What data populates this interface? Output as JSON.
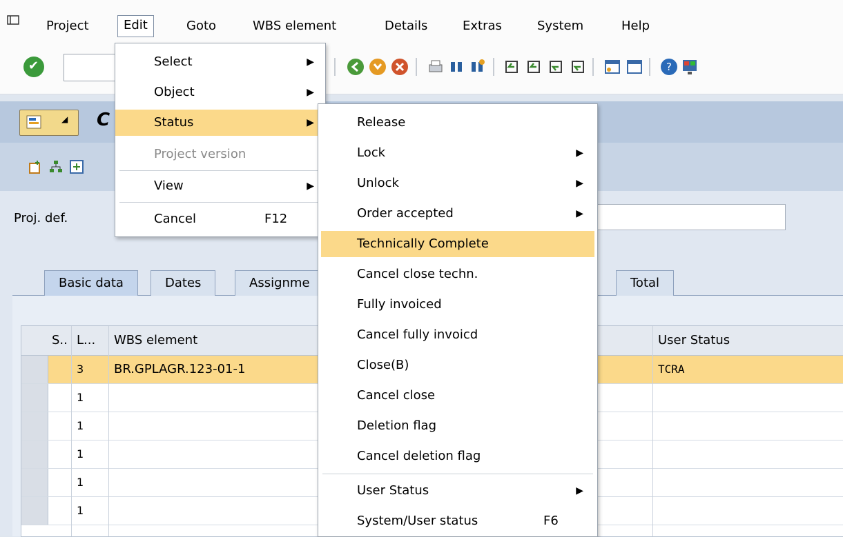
{
  "menubar": {
    "items": [
      "Project",
      "Edit",
      "Goto",
      "WBS element",
      "Details",
      "Extras",
      "System",
      "Help"
    ]
  },
  "title": {
    "text": "C"
  },
  "form": {
    "proj_def_label": "Proj. def."
  },
  "tabs": [
    "Basic data",
    "Dates",
    "Assignme",
    "Total"
  ],
  "grid": {
    "headers": [
      "S..",
      "L...",
      "WBS element",
      "User Status"
    ],
    "rows": [
      {
        "level": "3",
        "wbs": "BR.GPLAGR.123-01-1",
        "user_status": "TCRA"
      },
      {
        "level": "1",
        "wbs": "",
        "user_status": ""
      },
      {
        "level": "1",
        "wbs": "",
        "user_status": ""
      },
      {
        "level": "1",
        "wbs": "",
        "user_status": ""
      },
      {
        "level": "1",
        "wbs": "",
        "user_status": ""
      },
      {
        "level": "1",
        "wbs": "",
        "user_status": ""
      }
    ]
  },
  "edit_menu": {
    "items": [
      {
        "label": "Select",
        "submenu": true
      },
      {
        "label": "Object",
        "submenu": true
      },
      {
        "label": "Status",
        "submenu": true,
        "highlighted": true
      },
      {
        "label": "Project version",
        "disabled": true
      },
      {
        "label": "View",
        "submenu": true
      },
      {
        "label": "Cancel",
        "shortcut": "F12"
      }
    ]
  },
  "status_menu": {
    "items": [
      {
        "label": "Release"
      },
      {
        "label": "Lock",
        "submenu": true
      },
      {
        "label": "Unlock",
        "submenu": true
      },
      {
        "label": "Order accepted",
        "submenu": true
      },
      {
        "label": "Technically Complete",
        "highlighted": true
      },
      {
        "label": "Cancel close techn."
      },
      {
        "label": "Fully invoiced"
      },
      {
        "label": "Cancel fully invoicd"
      },
      {
        "label": "Close(B)"
      },
      {
        "label": "Cancel close"
      },
      {
        "label": "Deletion flag"
      },
      {
        "label": "Cancel deletion flag"
      },
      {
        "label": "User Status",
        "submenu": true
      },
      {
        "label": "System/User status",
        "shortcut": "F6"
      }
    ]
  },
  "colors": {
    "highlight": "#fbd98a",
    "titlebar": "#b7c8de"
  }
}
